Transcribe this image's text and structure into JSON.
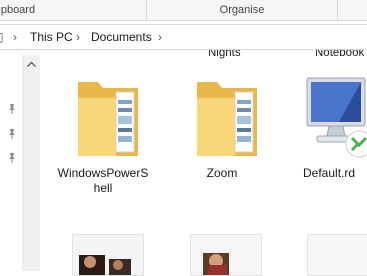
{
  "ribbon": {
    "groups": [
      {
        "label": "Clipboard"
      },
      {
        "label": "Organise"
      },
      {
        "label": ""
      }
    ]
  },
  "address": {
    "segments": [
      "This PC",
      "Documents"
    ]
  },
  "items_top_clipped": [
    "Nights",
    "Notebook"
  ],
  "items": [
    {
      "name_line1": "WindowsPowerS",
      "name_line2": "hell",
      "icon": "folder-icon"
    },
    {
      "name_line1": "Zoom",
      "name_line2": "",
      "icon": "folder-icon"
    },
    {
      "name_line1": "Default.rd",
      "name_line2": "",
      "icon": "remote-desktop-file-icon"
    }
  ],
  "thumbnails": [
    {
      "icon": "image-thumbnail"
    },
    {
      "icon": "image-thumbnail"
    },
    {
      "icon": "image-thumbnail"
    }
  ],
  "colors": {
    "folder_back": "#e8b84a",
    "folder_front": "#f7d77a",
    "accent": "#1e6fd9"
  }
}
